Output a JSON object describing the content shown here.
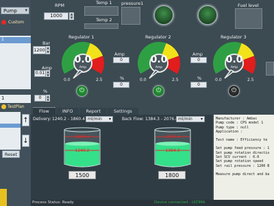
{
  "sidebar": {
    "pump_select": "Pump",
    "custom_label": "Custom",
    "list_top_selected": "1",
    "f1_value": "1",
    "testplan_label": "TestPlan",
    "up_icon": "arrow-up-icon",
    "down_icon": "arrow-down-icon",
    "reset_label": "Reset"
  },
  "top": {
    "rpm_label": "RPM",
    "rpm_value": "1000",
    "temp1_label": "Temp 1",
    "temp2_label": "Temp 2",
    "pressure1_label": "pressure1",
    "fuel_level_label": "Fuel level"
  },
  "left_controls": {
    "bar_label": "Bar",
    "bar_value": "1200",
    "amp_label": "Amp",
    "amp_value": "0.01",
    "pct_label": "%",
    "pct_value": "0"
  },
  "regulators": [
    {
      "title": "Regulator 1",
      "value": "0.0",
      "unit": "Amp",
      "min": "0.0",
      "max": "2.5",
      "amp_label": "",
      "amp_value": "",
      "pct_label": "",
      "pct_value": "",
      "power_on": true
    },
    {
      "title": "Regulator 2",
      "value": "0.0",
      "unit": "Amp",
      "min": "0.0",
      "max": "2.5",
      "amp_label": "Amp",
      "amp_value": "0",
      "pct_label": "%",
      "pct_value": "0",
      "power_on": true
    },
    {
      "title": "Regulator 3",
      "value": "0.0",
      "unit": "Amp",
      "min": "0.0",
      "max": "2.5",
      "amp_label": "Amp",
      "amp_value": "0",
      "pct_label": "%",
      "pct_value": "0",
      "power_on": false
    }
  ],
  "tabs": [
    "Flow",
    "INFO",
    "Report",
    "Settings"
  ],
  "flow": {
    "delivery_label": "Delivery:",
    "delivery_range": "1240.2 - 1860.4",
    "delivery_unit": "ml/min",
    "backflow_label": "Back Flow:",
    "backflow_range": "1384.3 - 2076.4",
    "backflow_unit": "ml/min",
    "beaker1": {
      "upper": "1860.4",
      "lower": "1240.2",
      "value": "1500",
      "level": 0.62
    },
    "beaker2": {
      "upper": "2076.4",
      "lower": "1384.3",
      "value": "1800",
      "level": 0.62
    }
  },
  "info_lines": [
    "Manufacturer : Ambac",
    "Pump code : CPS model 1",
    "Pump type : null",
    "Application :",
    "",
    "Test name : Efficiency te",
    "",
    "Set pump feed pressure : 1",
    "Set pump rotation directio",
    "Set SCV current : 0.0",
    "Set pump rotation speed",
    "Set rail pressure : 1200 B",
    "",
    "Measure pump direct and ba"
  ],
  "status": {
    "left": "Process Status: Ready",
    "right": "Device connected : ULTIMA"
  },
  "colors": {
    "gauge_green": "#2ea043",
    "gauge_yellow": "#f2e21a",
    "gauge_red": "#e21d1d",
    "liquid": "#35e08a"
  }
}
